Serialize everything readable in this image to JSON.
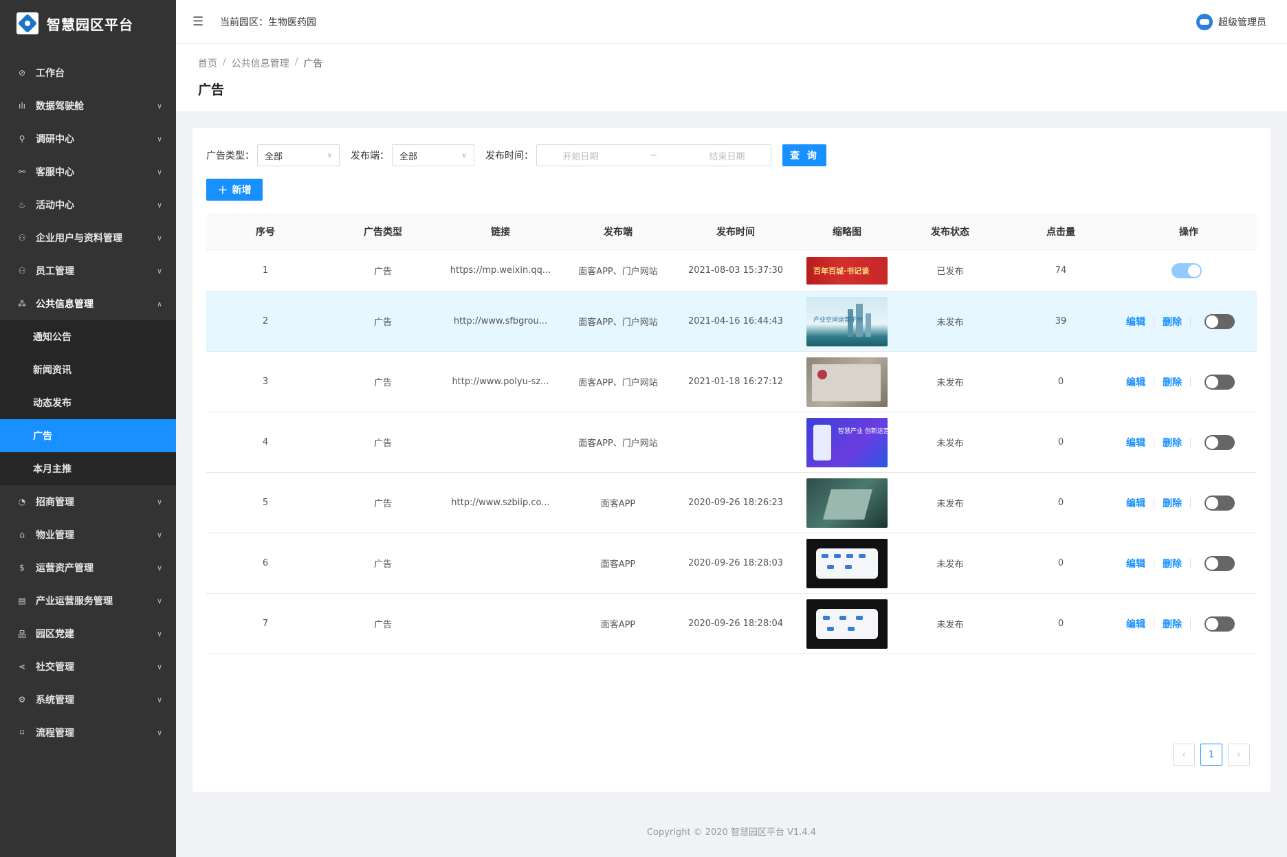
{
  "app": {
    "title": "智慧园区平台",
    "park_label": "当前园区：生物医药园",
    "user_name": "超级管理员"
  },
  "sidebar": {
    "items": [
      {
        "icon": "dashboard-icon",
        "glyph": "⊘",
        "label": "工作台",
        "has_children": false
      },
      {
        "icon": "chart-icon",
        "glyph": "ılı",
        "label": "数据驾驶舱",
        "has_children": true
      },
      {
        "icon": "search-icon",
        "glyph": "⚲",
        "label": "调研中心",
        "has_children": true
      },
      {
        "icon": "link-icon",
        "glyph": "⚯",
        "label": "客服中心",
        "has_children": true
      },
      {
        "icon": "fire-icon",
        "glyph": "♨",
        "label": "活动中心",
        "has_children": true
      },
      {
        "icon": "team-icon",
        "glyph": "⚇",
        "label": "企业用户与资料管理",
        "has_children": true
      },
      {
        "icon": "staff-icon",
        "glyph": "⚇",
        "label": "员工管理",
        "has_children": true
      },
      {
        "icon": "cluster-icon",
        "glyph": "⁂",
        "label": "公共信息管理",
        "has_children": true,
        "open": true
      },
      {
        "icon": "pie-icon",
        "glyph": "◔",
        "label": "招商管理",
        "has_children": true
      },
      {
        "icon": "home-icon",
        "glyph": "⌂",
        "label": "物业管理",
        "has_children": true
      },
      {
        "icon": "dollar-icon",
        "glyph": "$",
        "label": "运营资产管理",
        "has_children": true
      },
      {
        "icon": "file-icon",
        "glyph": "▤",
        "label": "产业运营服务管理",
        "has_children": true
      },
      {
        "icon": "apartment-icon",
        "glyph": "品",
        "label": "园区党建",
        "has_children": true
      },
      {
        "icon": "share-icon",
        "glyph": "⋖",
        "label": "社交管理",
        "has_children": true
      },
      {
        "icon": "setting-icon",
        "glyph": "⚙",
        "label": "系统管理",
        "has_children": true
      },
      {
        "icon": "flow-icon",
        "glyph": "⌑",
        "label": "流程管理",
        "has_children": true
      }
    ],
    "submenu": [
      {
        "label": "通知公告",
        "active": false
      },
      {
        "label": "新闻资讯",
        "active": false
      },
      {
        "label": "动态发布",
        "active": false
      },
      {
        "label": "广告",
        "active": true
      },
      {
        "label": "本月主推",
        "active": false
      }
    ]
  },
  "breadcrumb": {
    "home": "首页",
    "section": "公共信息管理",
    "current": "广告",
    "sep": "/"
  },
  "page_title": "广告",
  "filters": {
    "type_label": "广告类型：",
    "type_value": "全部",
    "platform_label": "发布端：",
    "platform_value": "全部",
    "time_label": "发布时间：",
    "start_placeholder": "开始日期",
    "range_sep": "~",
    "end_placeholder": "结束日期",
    "query_label": "查 询"
  },
  "add_label": "新增",
  "table": {
    "columns": [
      "序号",
      "广告类型",
      "链接",
      "发布端",
      "发布时间",
      "缩略图",
      "发布状态",
      "点击量",
      "操作"
    ],
    "edit_label": "编辑",
    "delete_label": "删除",
    "rows": [
      {
        "no": "1",
        "type": "广告",
        "link": "https://mp.weixin.qq...",
        "platform": "面客APP、门户网站",
        "time": "2021-08-03 15:37:30",
        "thumb_text": "百年百城·书记谈",
        "status": "已发布",
        "clicks": "74",
        "published": true
      },
      {
        "no": "2",
        "type": "广告",
        "link": "http://www.sfbgrou...",
        "platform": "面客APP、门户网站",
        "time": "2021-04-16 16:44:43",
        "thumb_text": "产业空间运营平台",
        "status": "未发布",
        "clicks": "39",
        "published": false
      },
      {
        "no": "3",
        "type": "广告",
        "link": "http://www.polyu-sz...",
        "platform": "面客APP、门户网站",
        "time": "2021-01-18 16:27:12",
        "thumb_text": "",
        "status": "未发布",
        "clicks": "0",
        "published": false
      },
      {
        "no": "4",
        "type": "广告",
        "link": "",
        "platform": "面客APP、门户网站",
        "time": "",
        "thumb_text": "智慧产业 创新运营",
        "status": "未发布",
        "clicks": "0",
        "published": false
      },
      {
        "no": "5",
        "type": "广告",
        "link": "http://www.szbiip.co...",
        "platform": "面客APP",
        "time": "2020-09-26 18:26:23",
        "thumb_text": "",
        "status": "未发布",
        "clicks": "0",
        "published": false
      },
      {
        "no": "6",
        "type": "广告",
        "link": "",
        "platform": "面客APP",
        "time": "2020-09-26 18:28:03",
        "thumb_text": "",
        "status": "未发布",
        "clicks": "0",
        "published": false
      },
      {
        "no": "7",
        "type": "广告",
        "link": "",
        "platform": "面客APP",
        "time": "2020-09-26 18:28:04",
        "thumb_text": "",
        "status": "未发布",
        "clicks": "0",
        "published": false
      }
    ]
  },
  "pagination": {
    "prev": "‹",
    "current": "1",
    "next": "›"
  },
  "footer": "Copyright © 2020 智慧园区平台 V1.4.4",
  "colors": {
    "primary": "#1890ff",
    "sidebar": "#333333",
    "highlight_row": "#e6f7ff"
  }
}
